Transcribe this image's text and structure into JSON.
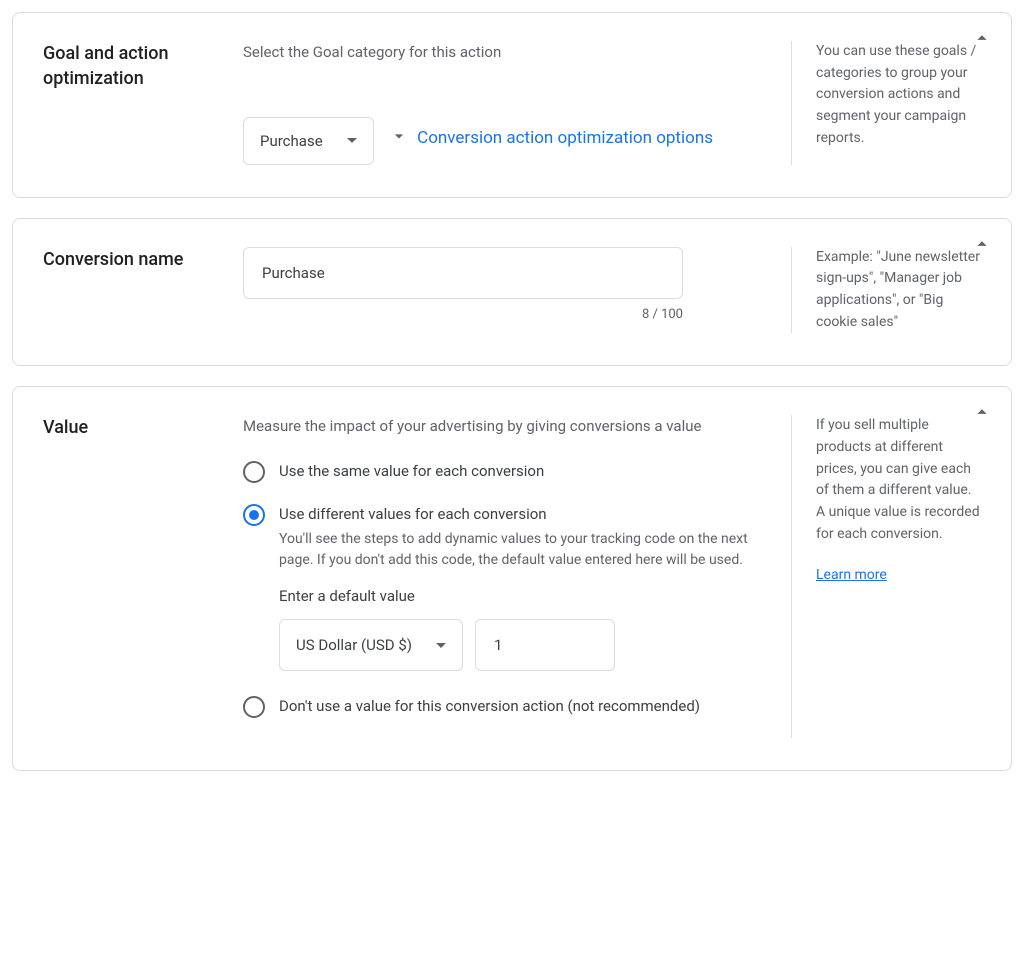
{
  "card1": {
    "title": "Goal and action optimization",
    "desc": "Select the Goal category for this action",
    "select_value": "Purchase",
    "expand_label": "Conversion action optimization options",
    "help": "You can use these goals / categories to group your conversion actions and segment your campaign reports."
  },
  "card2": {
    "title": "Conversion name",
    "input_value": "Purchase",
    "char_count": "8 / 100",
    "help": "Example: \"June newsletter sign-ups\", \"Manager job applications\", or \"Big cookie sales\""
  },
  "card3": {
    "title": "Value",
    "desc": "Measure the impact of your advertising by giving conversions a value",
    "opt_same": "Use the same value for each conversion",
    "opt_diff": "Use different values for each conversion",
    "opt_diff_sub": "You'll see the steps to add dynamic values to your tracking code on the next page. If you don't add this code, the default value entered here will be used.",
    "default_label": "Enter a default value",
    "currency": "US Dollar (USD $)",
    "default_value": "1",
    "opt_none": "Don't use a value for this conversion action (not recommended)",
    "help": "If you sell multiple products at different prices, you can give each of them a different value. A unique value is recorded for each conversion.",
    "learn_more": "Learn more"
  }
}
